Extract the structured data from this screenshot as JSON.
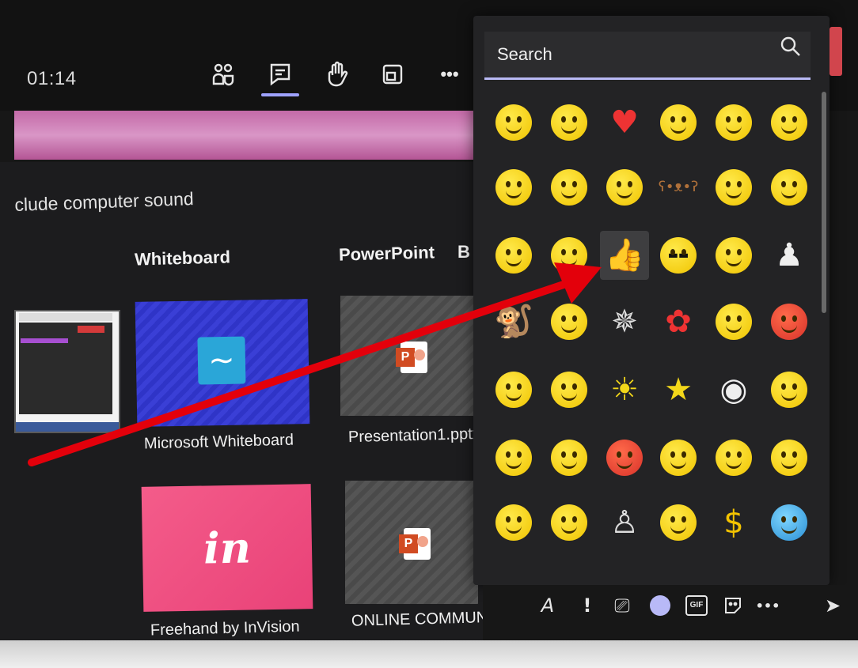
{
  "meeting_bar": {
    "timer": "01:14",
    "controls": [
      {
        "name": "people-icon",
        "label": ""
      },
      {
        "name": "chat-icon",
        "label": ""
      },
      {
        "name": "raise-hand-icon",
        "label": ""
      },
      {
        "name": "share-tray-icon",
        "label": ""
      },
      {
        "name": "more-options-icon",
        "label": "•••"
      }
    ],
    "accent": "#9ea2ff"
  },
  "share_tray": {
    "sound_option": "clude computer sound",
    "sections": {
      "whiteboard": "Whiteboard",
      "powerpoint": "PowerPoint",
      "browse": "B"
    },
    "tiles": {
      "whiteboard_caption": "Microsoft Whiteboard",
      "pptx_caption": "Presentation1.pptx",
      "freehand_caption": "Freehand by InVision",
      "online_caption": "ONLINE COMMUNICA",
      "freehand_logo": "in",
      "ppt_letter": "P",
      "whiteboard_glyph": "~"
    }
  },
  "emoji_panel": {
    "search_placeholder": "Search",
    "selected_emoji": "thumbs-up",
    "rows": [
      [
        "smile",
        "laugh",
        "heart",
        "kiss",
        "sad",
        "tongue-out"
      ],
      [
        "wink",
        "cry",
        "devil-horns",
        "teddy-bear",
        "rofl",
        "blush"
      ],
      [
        "surprised",
        "peeking",
        "thumbs-up",
        "cool-sunglasses",
        "laughing-hard",
        "penguin-tux"
      ],
      [
        "monkey",
        "giggle",
        "dancer",
        "flower",
        "thinking",
        "angry-devil"
      ],
      [
        "party",
        "worried",
        "sun",
        "star",
        "polar-bear",
        "meh"
      ],
      [
        "neutral",
        "skeptical",
        "angry",
        "sick",
        "facepalm",
        "sweat"
      ],
      [
        "excited",
        "sleepy",
        "man",
        "lips-sealed",
        "dollar",
        "cold-face"
      ]
    ],
    "glyphs": {
      "heart": "♥",
      "teddy-bear": "ʕ•ᴥ•ʔ",
      "thumbs-up": "👍",
      "cool-sunglasses": "▬▬",
      "flower": "✿",
      "star": "★",
      "sun": "☀",
      "dollar": "$",
      "monkey": "🐒",
      "penguin-tux": "♟",
      "man": "♙",
      "polar-bear": "◉",
      "dancer": "✵"
    }
  },
  "compose_bar": {
    "format": "A",
    "important": "!",
    "attach": "⎚",
    "gif": "GIF",
    "more": "•••",
    "send": "➤"
  },
  "annotation": {
    "arrow_color": "#e3000b"
  }
}
